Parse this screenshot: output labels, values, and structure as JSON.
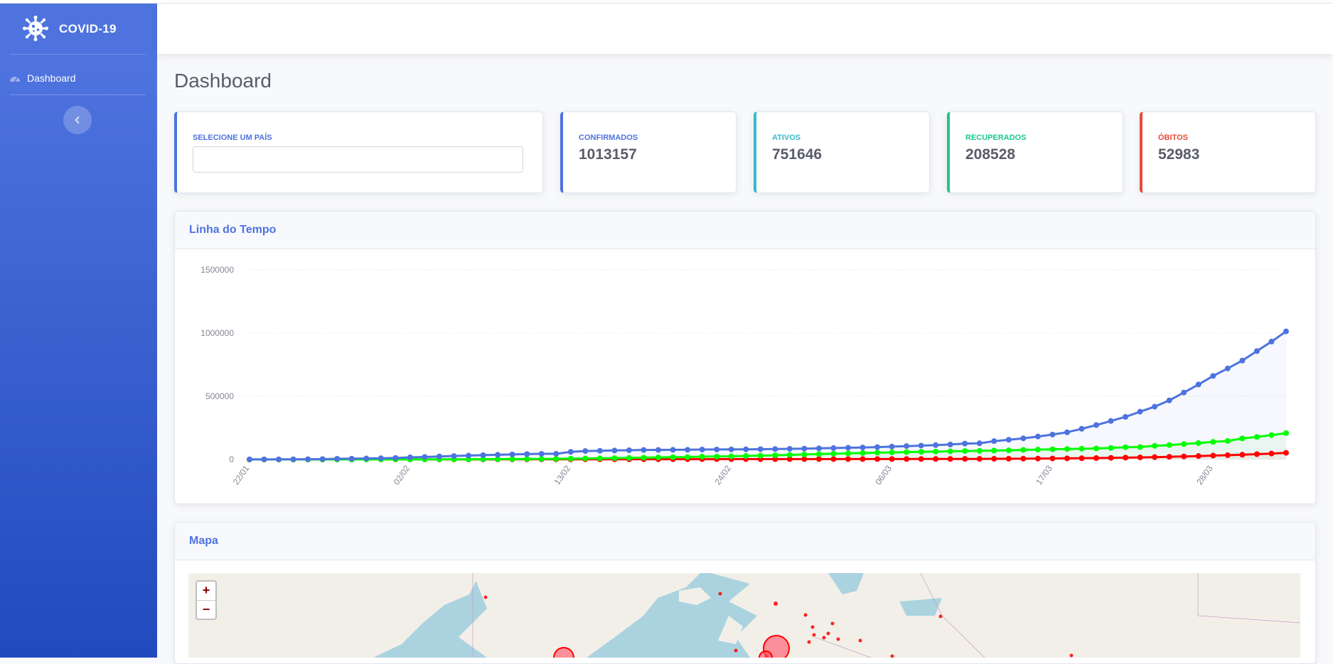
{
  "sidebar": {
    "brand": "COVID-19",
    "items": [
      {
        "label": "Dashboard",
        "icon": "tachometer-icon"
      }
    ],
    "toggle_icon": "chevron-left-icon"
  },
  "page": {
    "title": "Dashboard"
  },
  "select_country": {
    "label": "SELECIONE UM PAÍS",
    "value": "",
    "placeholder": ""
  },
  "stats": [
    {
      "label": "CONFIRMADOS",
      "value": "1013157",
      "color": "#4e73df"
    },
    {
      "label": "ATIVOS",
      "value": "751646",
      "color": "#36b9cc"
    },
    {
      "label": "RECUPERADOS",
      "value": "208528",
      "color": "#1cc88a"
    },
    {
      "label": "ÓBITOS",
      "value": "52983",
      "color": "#e74a3b"
    }
  ],
  "timeline": {
    "title": "Linha do Tempo",
    "chart_data": {
      "type": "line",
      "x_start": "22/01",
      "x_tick_labels": [
        "22/01",
        "02/02",
        "13/02",
        "24/02",
        "06/03",
        "17/03",
        "28/03"
      ],
      "y_ticks": [
        0,
        500000,
        1000000,
        1500000
      ],
      "ylim": [
        0,
        1500000
      ],
      "grid": true,
      "series": [
        {
          "color": "#4e73df",
          "values": [
            555,
            654,
            941,
            1434,
            2118,
            2927,
            5578,
            6166,
            8234,
            9927,
            12038,
            16787,
            19881,
            23892,
            27635,
            30794,
            34391,
            37120,
            40150,
            42762,
            44802,
            45221,
            60368,
            66885,
            69030,
            71224,
            73258,
            75136,
            75639,
            76197,
            76819,
            78572,
            78958,
            79561,
            80406,
            81388,
            82746,
            84112,
            86011,
            88369,
            90306,
            92840,
            95120,
            97886,
            101801,
            105847,
            109821,
            113590,
            118620,
            125875,
            128343,
            145193,
            156097,
            167449,
            181546,
            197168,
            214915,
            242713,
            272167,
            304528,
            337020,
            378287,
            417966,
            467594,
            529591,
            593291,
            660706,
            720117,
            782365,
            857487,
            932605,
            1013157
          ]
        },
        {
          "color": "#00ff00",
          "values": [
            28,
            30,
            36,
            39,
            52,
            61,
            107,
            126,
            143,
            222,
            284,
            472,
            623,
            852,
            1124,
            1487,
            2011,
            2616,
            3244,
            3946,
            4683,
            5150,
            6295,
            8058,
            9395,
            10865,
            12583,
            14352,
            16121,
            18177,
            18890,
            22886,
            23394,
            25227,
            27905,
            30384,
            33277,
            36711,
            39782,
            42716,
            45602,
            48228,
            51170,
            53796,
            55865,
            58358,
            60694,
            62494,
            64404,
            67003,
            68324,
            70251,
            72624,
            76034,
            78088,
            80840,
            83207,
            84854,
            87256,
            91331,
            97198,
            98351,
            108000,
            114218,
            121966,
            129865,
            139124,
            146823,
            166346,
            178063,
            192781,
            208528
          ]
        },
        {
          "color": "#ff0000",
          "values": [
            17,
            18,
            26,
            42,
            56,
            82,
            131,
            133,
            171,
            213,
            259,
            362,
            426,
            492,
            564,
            634,
            719,
            806,
            906,
            1013,
            1113,
            1118,
            1371,
            1523,
            1666,
            1770,
            1868,
            2007,
            2122,
            2247,
            2251,
            2458,
            2469,
            2629,
            2708,
            2770,
            2814,
            2872,
            2941,
            2996,
            3085,
            3160,
            3254,
            3348,
            3460,
            3558,
            3802,
            3988,
            4262,
            4615,
            4720,
            5404,
            5819,
            6440,
            7126,
            7905,
            8733,
            9867,
            11299,
            12973,
            14623,
            16497,
            18615,
            21181,
            23970,
            27198,
            30652,
            33925,
            37582,
            42107,
            46809,
            52983
          ]
        }
      ]
    }
  },
  "map": {
    "title": "Mapa",
    "zoom_in": "+",
    "zoom_out": "−"
  }
}
